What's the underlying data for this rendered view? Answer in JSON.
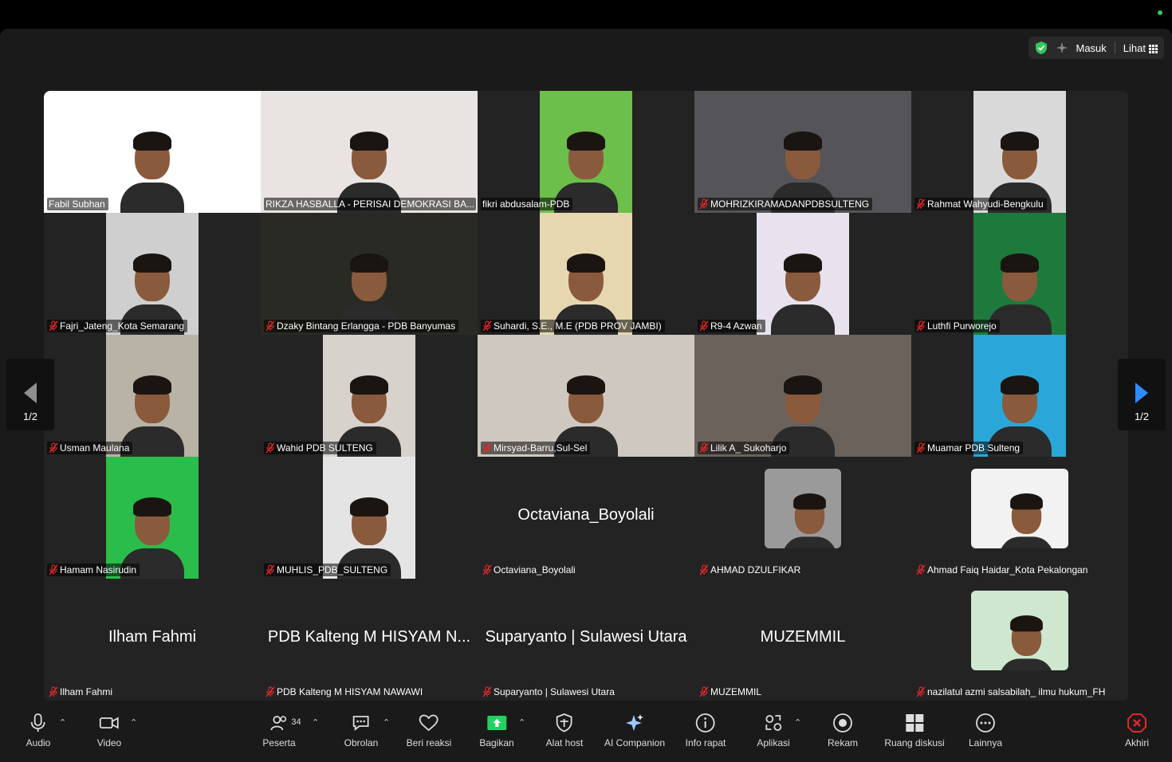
{
  "topbar": {
    "login_label": "Masuk",
    "view_label": "Lihat",
    "shield_color": "#34c759"
  },
  "pagination": {
    "left_label": "1/2",
    "right_label": "1/2"
  },
  "tiles": [
    {
      "name": "Fabil Subhan",
      "muted": false,
      "bg": "#ffffff",
      "mode": "full"
    },
    {
      "name": "RIKZA HASBALLA - PERISAI DEMOKRASI BA...",
      "muted": false,
      "bg": "#e9e4e2",
      "mode": "full",
      "active": true
    },
    {
      "name": "fikri abdusalam-PDB",
      "muted": false,
      "bg": "#6bbf4a",
      "mode": "center"
    },
    {
      "name": "MOHRIZKIRAMADANPDBSULTENG",
      "muted": true,
      "bg": "#555458",
      "mode": "full"
    },
    {
      "name": "Rahmat Wahyudi-Bengkulu",
      "muted": true,
      "bg": "#d9d9d9",
      "mode": "center"
    },
    {
      "name": "Fajri_Jateng_Kota Semarang",
      "muted": true,
      "bg": "#cfcfcf",
      "mode": "center"
    },
    {
      "name": "Dzaky Bintang Erlangga - PDB Banyumas",
      "muted": true,
      "bg": "#2a2a24",
      "mode": "full"
    },
    {
      "name": "Suhardi, S.E., M.E (PDB PROV JAMBI)",
      "muted": true,
      "bg": "#e6d7b0",
      "mode": "center"
    },
    {
      "name": "R9-4 Azwan",
      "muted": true,
      "bg": "#e8e2ee",
      "mode": "center"
    },
    {
      "name": "Luthfi Purworejo",
      "muted": true,
      "bg": "#1d7a3c",
      "mode": "center"
    },
    {
      "name": "Usman Maulana",
      "muted": true,
      "bg": "#b9b3a6",
      "mode": "center"
    },
    {
      "name": "Wahid PDB SULTENG",
      "muted": true,
      "bg": "#d8d2cc",
      "mode": "center"
    },
    {
      "name": "Mirsyad-Barru,Sul-Sel",
      "muted": true,
      "bg": "#cfc8c0",
      "mode": "full"
    },
    {
      "name": "Lilik A_ Sukoharjo",
      "muted": true,
      "bg": "#6b625b",
      "mode": "full"
    },
    {
      "name": "Muamar PDB Sulteng",
      "muted": true,
      "bg": "#2aa7d8",
      "mode": "center"
    },
    {
      "name": "Hamam Nasirudin",
      "muted": true,
      "bg": "#2bbd4b",
      "mode": "center"
    },
    {
      "name": "MUHLIS_PDB_SULTENG",
      "muted": true,
      "bg": "#e4e4e4",
      "mode": "center"
    },
    {
      "name": "Octaviana_Boyolali",
      "muted": true,
      "big": "Octaviana_Boyolali",
      "mode": "none"
    },
    {
      "name": "AHMAD DZULFIKAR",
      "muted": true,
      "mode": "photo",
      "bg": "#9a9a9a"
    },
    {
      "name": "Ahmad Faiq Haidar_Kota Pekalongan",
      "muted": true,
      "mode": "photo",
      "bg": "#f2f2f2"
    },
    {
      "name": "Ilham Fahmi",
      "muted": true,
      "big": "Ilham Fahmi",
      "mode": "none"
    },
    {
      "name": "PDB Kalteng M HISYAM NAWAWI",
      "muted": true,
      "big": "PDB Kalteng M HISYAM N...",
      "mode": "none"
    },
    {
      "name": "Suparyanto | Sulawesi Utara",
      "muted": true,
      "big": "Suparyanto | Sulawesi Utara",
      "mode": "none"
    },
    {
      "name": "MUZEMMIL",
      "muted": true,
      "big": "MUZEMMIL",
      "mode": "none"
    },
    {
      "name": "nazilatul azmi salsabilah_ ilmu hukum_FH",
      "muted": true,
      "mode": "photo",
      "bg": "#cfe6cf"
    }
  ],
  "toolbar": {
    "audio": "Audio",
    "video": "Video",
    "participants": "Peserta",
    "participants_count": "34",
    "chat": "Obrolan",
    "reactions": "Beri reaksi",
    "share": "Bagikan",
    "host_tools": "Alat host",
    "ai_companion": "AI Companion",
    "meeting_info": "Info rapat",
    "apps": "Aplikasi",
    "record": "Rekam",
    "breakout": "Ruang diskusi",
    "more": "Lainnya",
    "end": "Akhiri",
    "share_color": "#23d160",
    "end_color": "#e02828"
  }
}
